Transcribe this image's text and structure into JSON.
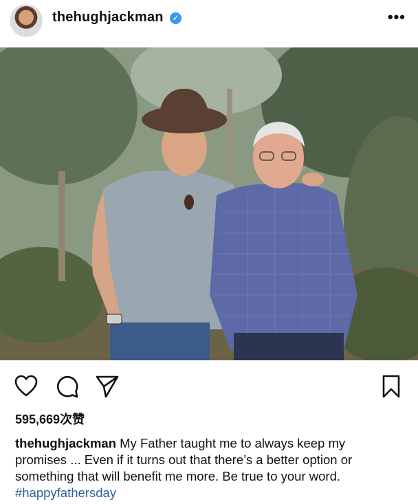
{
  "post": {
    "username": "thehughjackman",
    "verified_icon": "verified-badge-icon",
    "more_label": "•••",
    "likes": "595,669次赞",
    "caption": {
      "username": "thehughjackman",
      "text": "My Father taught me to always keep my promises ... Even if it turns out that there’s a better option or something that will benefit me more. Be true to your word.",
      "hashtag": "#happyfathersday"
    },
    "actions": {
      "like_icon": "heart-icon",
      "comment_icon": "comment-icon",
      "share_icon": "send-icon",
      "save_icon": "bookmark-icon"
    }
  }
}
